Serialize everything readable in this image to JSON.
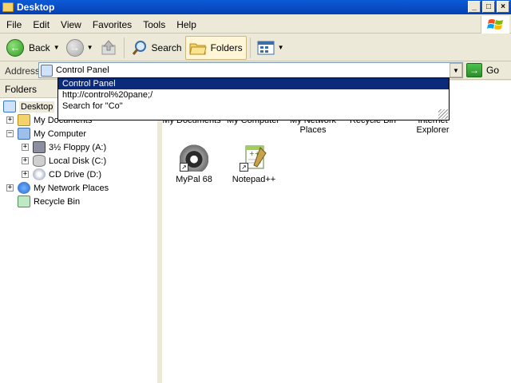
{
  "window": {
    "title": "Desktop",
    "controls": [
      "_",
      "□",
      "×"
    ]
  },
  "menu": [
    "File",
    "Edit",
    "View",
    "Favorites",
    "Tools",
    "Help"
  ],
  "toolbar": {
    "back_label": "Back",
    "search_label": "Search",
    "folders_label": "Folders"
  },
  "address": {
    "label": "Address",
    "value": "Control Panel",
    "go_label": "Go"
  },
  "autocomplete": {
    "items": [
      "Control Panel",
      "http://control%20pane;/",
      "Search for \"Co\""
    ]
  },
  "folders_pane": {
    "header": "Folders",
    "items": [
      {
        "label": "Desktop",
        "icon": "desktop-icon",
        "expander": ""
      },
      {
        "label": "My Documents",
        "icon": "my-documents-icon",
        "expander": "+"
      },
      {
        "label": "My Computer",
        "icon": "my-computer-icon",
        "expander": "−"
      },
      {
        "label": "3½ Floppy (A:)",
        "icon": "floppy-icon",
        "expander": "+"
      },
      {
        "label": "Local Disk (C:)",
        "icon": "local-disk-icon",
        "expander": "+"
      },
      {
        "label": "CD Drive (D:)",
        "icon": "cd-drive-icon",
        "expander": "+"
      },
      {
        "label": "My Network Places",
        "icon": "network-places-icon",
        "expander": "+"
      },
      {
        "label": "Recycle Bin",
        "icon": "recycle-bin-icon",
        "expander": ""
      }
    ]
  },
  "content": {
    "partial_labels": [
      {
        "line1": "My Documents",
        "line2": ""
      },
      {
        "line1": "My Computer",
        "line2": ""
      },
      {
        "line1": "My Network",
        "line2": "Places"
      },
      {
        "line1": "Recycle Bin",
        "line2": ""
      },
      {
        "line1": "Internet",
        "line2": "Explorer"
      }
    ],
    "icons": [
      {
        "label": "MyPal 68",
        "icon": "mypal-raccoon-icon"
      },
      {
        "label": "Notepad++",
        "icon": "notepad-plus-plus-icon"
      }
    ]
  }
}
